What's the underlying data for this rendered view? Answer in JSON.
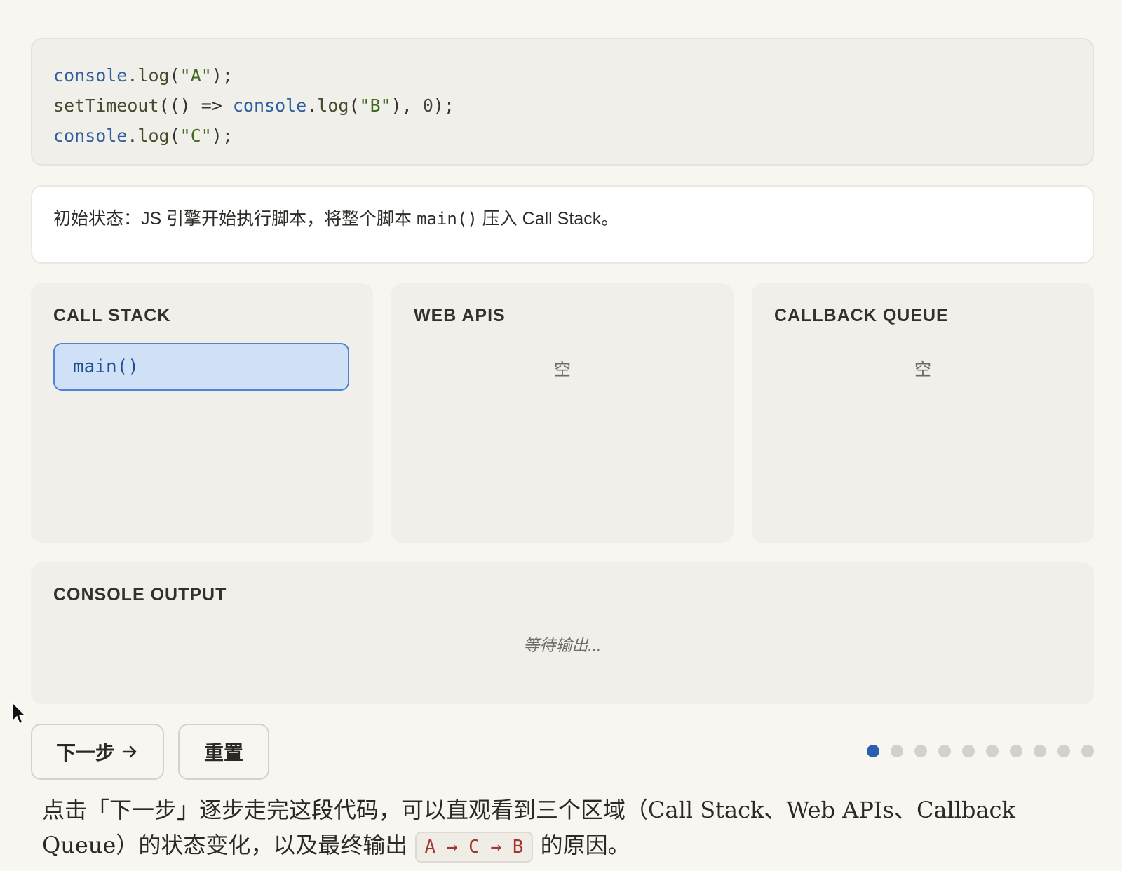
{
  "code": {
    "line1": {
      "obj": "console",
      "dot": ".",
      "fn": "log",
      "open": "(",
      "str": "\"A\"",
      "close": ");"
    },
    "line2": {
      "fn": "setTimeout",
      "open": "(() => ",
      "obj": "console",
      "dot": ".",
      "fn2": "log",
      "open2": "(",
      "str": "\"B\"",
      "close": "), ",
      "num": "0",
      "end": ");"
    },
    "line3": {
      "obj": "console",
      "dot": ".",
      "fn": "log",
      "open": "(",
      "str": "\"C\"",
      "close": ");"
    }
  },
  "description": {
    "prefix": "初始状态：JS 引擎开始执行脚本，将整个脚本 ",
    "code": "main()",
    "suffix": " 压入 Call Stack。"
  },
  "panels": {
    "call_stack": {
      "title": "CALL STACK",
      "frames": [
        "main()"
      ]
    },
    "web_apis": {
      "title": "WEB APIS",
      "empty": "空"
    },
    "callback_queue": {
      "title": "CALLBACK QUEUE",
      "empty": "空"
    }
  },
  "console": {
    "title": "CONSOLE OUTPUT",
    "placeholder": "等待输出..."
  },
  "controls": {
    "next_label": "下一步",
    "reset_label": "重置",
    "total_steps": 10,
    "current_step": 1
  },
  "footer": {
    "text_before": "点击「下一步」逐步走完这段代码，可以直观看到三个区域（Call Stack、Web APIs、Callback Queue）的状态变化，以及最终输出 ",
    "code": "A → C → B",
    "text_after": " 的原因。"
  },
  "colors": {
    "accent": "#2a5fb0",
    "frame_bg": "#cfe0f7",
    "frame_border": "#4d86d6",
    "inline_code": "#a3362e"
  },
  "icons": {
    "next_arrow": "arrow-right-icon",
    "cursor": "mouse-pointer-icon"
  }
}
